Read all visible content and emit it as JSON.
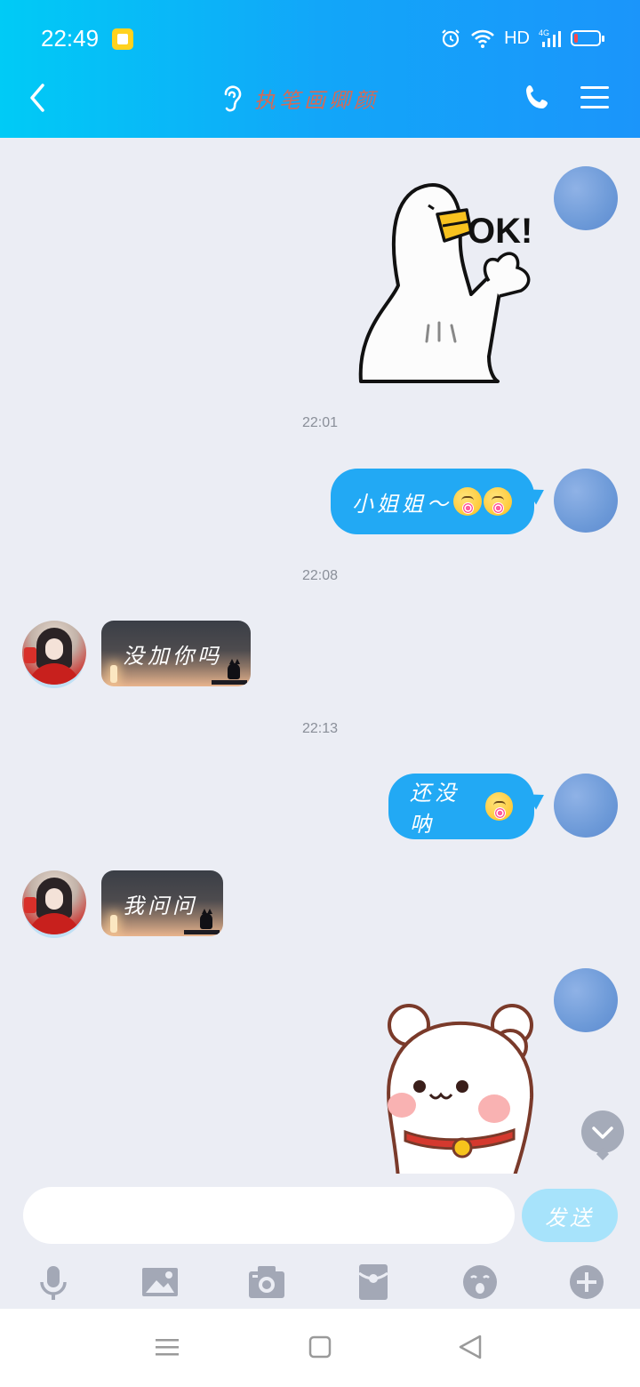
{
  "status_bar": {
    "time": "22:49",
    "network": "HD",
    "battery_level": 0.15
  },
  "header": {
    "title": "执笔画卿颜"
  },
  "messages": {
    "sticker_ok_text": "OK!",
    "timestamp_1": "22:01",
    "msg_1": "小姐姐～",
    "timestamp_2": "22:08",
    "msg_2": "没加你吗",
    "timestamp_3": "22:13",
    "msg_3": "还没呐",
    "msg_4": "我问问"
  },
  "composer": {
    "input_value": "",
    "send_label": "发送"
  },
  "colors": {
    "accent": "#1B95FA",
    "bubble_me": "#22A9F4",
    "send_disabled": "#A7E3FB",
    "background": "#EBEDF4"
  },
  "toolbar_icons": [
    "microphone-icon",
    "image-icon",
    "camera-icon",
    "red-packet-icon",
    "emoji-icon",
    "plus-icon"
  ],
  "nav_icons": [
    "menu-icon",
    "home-square-icon",
    "back-triangle-icon"
  ]
}
